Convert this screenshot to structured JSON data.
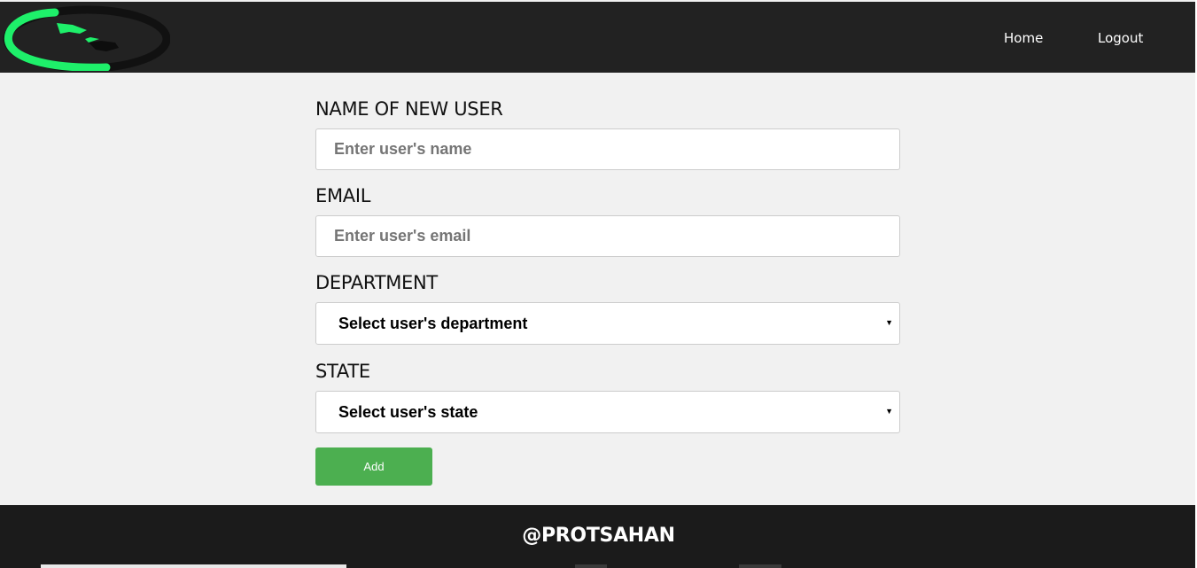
{
  "header": {
    "logo_alt": "logo",
    "nav": {
      "home": "Home",
      "logout": "Logout"
    }
  },
  "form": {
    "name_label": "NAME OF NEW USER",
    "name_placeholder": "Enter user's name",
    "email_label": "EMAIL",
    "email_placeholder": "Enter user's email",
    "department_label": "DEPARTMENT",
    "department_selected": "Select user's department",
    "state_label": "STATE",
    "state_selected": "Select user's state",
    "add_label": "Add"
  },
  "footer": {
    "text": "@PROTSAHAN"
  },
  "colors": {
    "header_bg": "#222222",
    "footer_bg": "#1b1b1b",
    "page_bg": "#f1f1f1",
    "accent_green": "#4caf50",
    "logo_green": "#1ef06a"
  },
  "icons": {
    "logo": "handshake-circle-logo",
    "select_arrow": "triangle-down-icon"
  }
}
